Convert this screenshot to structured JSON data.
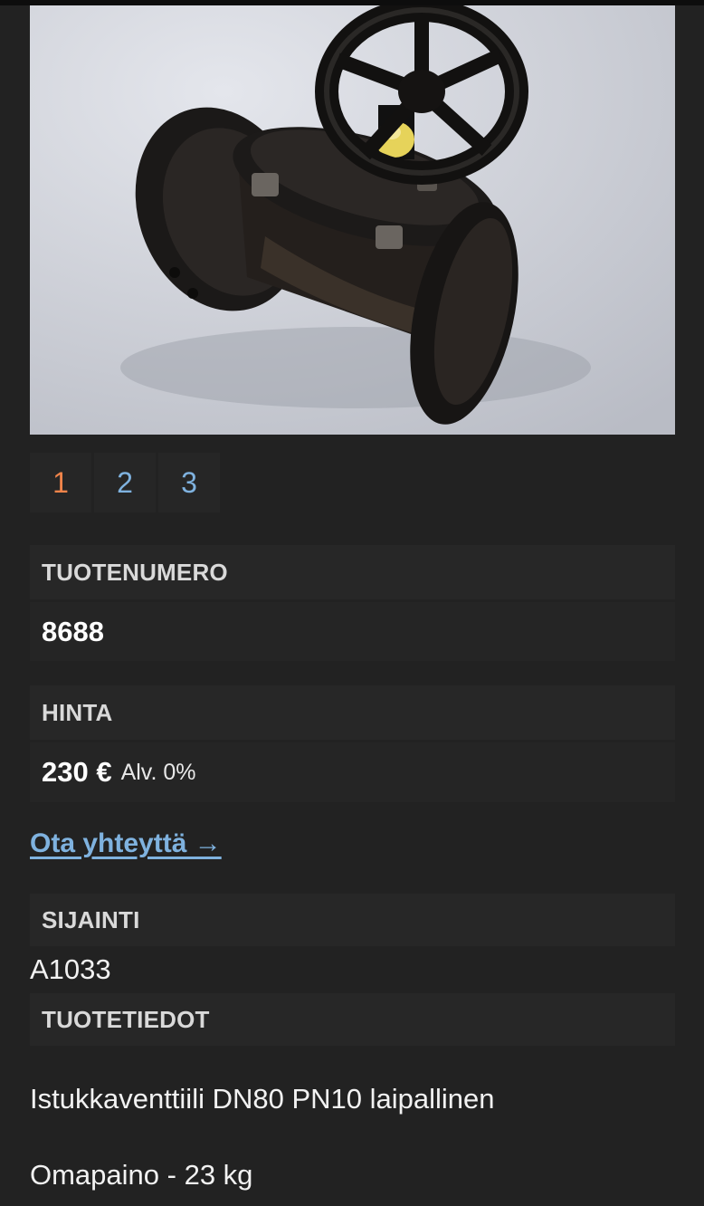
{
  "gallery": {
    "image_alt": "Istukkaventtiili",
    "pages": [
      "1",
      "2",
      "3"
    ],
    "active_page": "1"
  },
  "product_number": {
    "label": "TUOTENUMERO",
    "value": "8688"
  },
  "price": {
    "label": "HINTA",
    "value": "230 €",
    "vat": "Alv. 0%"
  },
  "contact": {
    "label": "Ota yhteyttä →"
  },
  "location": {
    "label": "SIJAINTI",
    "value": "A1033"
  },
  "details": {
    "label": "TUOTETIEDOT",
    "description": "Istukkaventtiili DN80 PN10 laipallinen",
    "weight": "Omapaino - 23 kg"
  },
  "colors": {
    "accent_active": "#f0844a",
    "link": "#7fb2df",
    "background": "#222222"
  }
}
